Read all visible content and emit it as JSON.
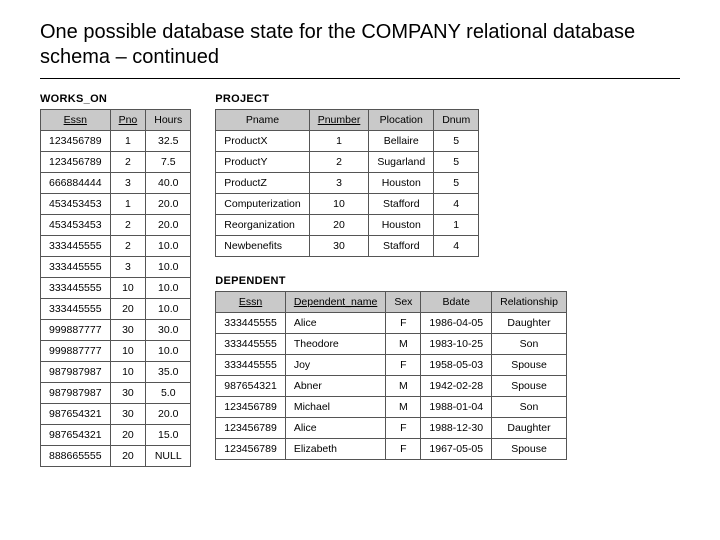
{
  "title": "One possible database state for the COMPANY relational database schema – continued",
  "tables": {
    "works_on": {
      "label": "WORKS_ON",
      "headers": [
        "Essn",
        "Pno",
        "Hours"
      ],
      "pk": [
        0,
        1
      ],
      "rows": [
        [
          "123456789",
          "1",
          "32.5"
        ],
        [
          "123456789",
          "2",
          "7.5"
        ],
        [
          "666884444",
          "3",
          "40.0"
        ],
        [
          "453453453",
          "1",
          "20.0"
        ],
        [
          "453453453",
          "2",
          "20.0"
        ],
        [
          "333445555",
          "2",
          "10.0"
        ],
        [
          "333445555",
          "3",
          "10.0"
        ],
        [
          "333445555",
          "10",
          "10.0"
        ],
        [
          "333445555",
          "20",
          "10.0"
        ],
        [
          "999887777",
          "30",
          "30.0"
        ],
        [
          "999887777",
          "10",
          "10.0"
        ],
        [
          "987987987",
          "10",
          "35.0"
        ],
        [
          "987987987",
          "30",
          "5.0"
        ],
        [
          "987654321",
          "30",
          "20.0"
        ],
        [
          "987654321",
          "20",
          "15.0"
        ],
        [
          "888665555",
          "20",
          "NULL"
        ]
      ]
    },
    "project": {
      "label": "PROJECT",
      "headers": [
        "Pname",
        "Pnumber",
        "Plocation",
        "Dnum"
      ],
      "pk": [
        1
      ],
      "rows": [
        [
          "ProductX",
          "1",
          "Bellaire",
          "5"
        ],
        [
          "ProductY",
          "2",
          "Sugarland",
          "5"
        ],
        [
          "ProductZ",
          "3",
          "Houston",
          "5"
        ],
        [
          "Computerization",
          "10",
          "Stafford",
          "4"
        ],
        [
          "Reorganization",
          "20",
          "Houston",
          "1"
        ],
        [
          "Newbenefits",
          "30",
          "Stafford",
          "4"
        ]
      ]
    },
    "dependent": {
      "label": "DEPENDENT",
      "headers": [
        "Essn",
        "Dependent_name",
        "Sex",
        "Bdate",
        "Relationship"
      ],
      "pk": [
        0,
        1
      ],
      "rows": [
        [
          "333445555",
          "Alice",
          "F",
          "1986-04-05",
          "Daughter"
        ],
        [
          "333445555",
          "Theodore",
          "M",
          "1983-10-25",
          "Son"
        ],
        [
          "333445555",
          "Joy",
          "F",
          "1958-05-03",
          "Spouse"
        ],
        [
          "987654321",
          "Abner",
          "M",
          "1942-02-28",
          "Spouse"
        ],
        [
          "123456789",
          "Michael",
          "M",
          "1988-01-04",
          "Son"
        ],
        [
          "123456789",
          "Alice",
          "F",
          "1988-12-30",
          "Daughter"
        ],
        [
          "123456789",
          "Elizabeth",
          "F",
          "1967-05-05",
          "Spouse"
        ]
      ]
    }
  }
}
